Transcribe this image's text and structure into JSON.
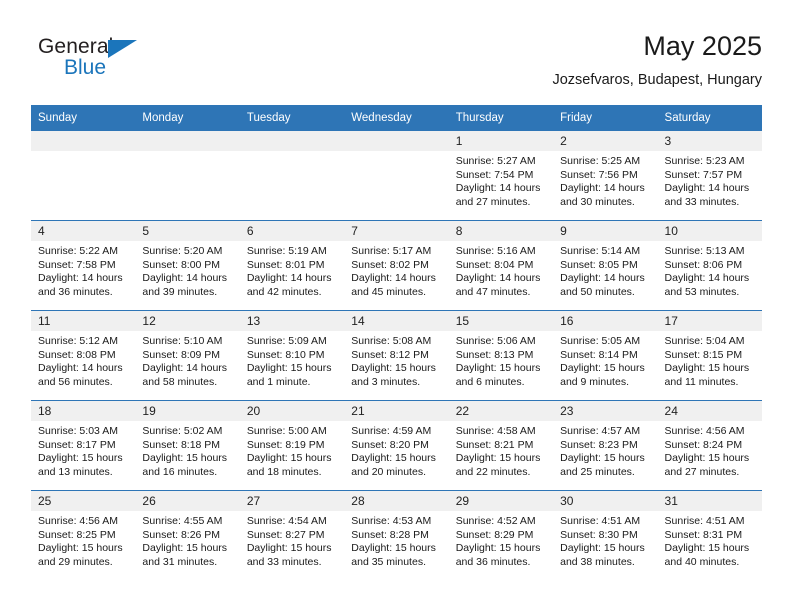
{
  "brand": {
    "name_part1": "General",
    "name_part2": "Blue",
    "flag_icon": "blue-flag-triangle",
    "accent_color": "#1b75bb"
  },
  "header": {
    "title": "May 2025",
    "subtitle": "Jozsefvaros, Budapest, Hungary"
  },
  "calendar": {
    "header_bg": "#2e75b6",
    "daynum_bg": "#f0f0f0",
    "weekday_headers": [
      "Sunday",
      "Monday",
      "Tuesday",
      "Wednesday",
      "Thursday",
      "Friday",
      "Saturday"
    ],
    "weeks": [
      [
        {
          "day": "",
          "sunrise": "",
          "sunset": "",
          "daylight": ""
        },
        {
          "day": "",
          "sunrise": "",
          "sunset": "",
          "daylight": ""
        },
        {
          "day": "",
          "sunrise": "",
          "sunset": "",
          "daylight": ""
        },
        {
          "day": "",
          "sunrise": "",
          "sunset": "",
          "daylight": ""
        },
        {
          "day": "1",
          "sunrise": "Sunrise: 5:27 AM",
          "sunset": "Sunset: 7:54 PM",
          "daylight": "Daylight: 14 hours and 27 minutes."
        },
        {
          "day": "2",
          "sunrise": "Sunrise: 5:25 AM",
          "sunset": "Sunset: 7:56 PM",
          "daylight": "Daylight: 14 hours and 30 minutes."
        },
        {
          "day": "3",
          "sunrise": "Sunrise: 5:23 AM",
          "sunset": "Sunset: 7:57 PM",
          "daylight": "Daylight: 14 hours and 33 minutes."
        }
      ],
      [
        {
          "day": "4",
          "sunrise": "Sunrise: 5:22 AM",
          "sunset": "Sunset: 7:58 PM",
          "daylight": "Daylight: 14 hours and 36 minutes."
        },
        {
          "day": "5",
          "sunrise": "Sunrise: 5:20 AM",
          "sunset": "Sunset: 8:00 PM",
          "daylight": "Daylight: 14 hours and 39 minutes."
        },
        {
          "day": "6",
          "sunrise": "Sunrise: 5:19 AM",
          "sunset": "Sunset: 8:01 PM",
          "daylight": "Daylight: 14 hours and 42 minutes."
        },
        {
          "day": "7",
          "sunrise": "Sunrise: 5:17 AM",
          "sunset": "Sunset: 8:02 PM",
          "daylight": "Daylight: 14 hours and 45 minutes."
        },
        {
          "day": "8",
          "sunrise": "Sunrise: 5:16 AM",
          "sunset": "Sunset: 8:04 PM",
          "daylight": "Daylight: 14 hours and 47 minutes."
        },
        {
          "day": "9",
          "sunrise": "Sunrise: 5:14 AM",
          "sunset": "Sunset: 8:05 PM",
          "daylight": "Daylight: 14 hours and 50 minutes."
        },
        {
          "day": "10",
          "sunrise": "Sunrise: 5:13 AM",
          "sunset": "Sunset: 8:06 PM",
          "daylight": "Daylight: 14 hours and 53 minutes."
        }
      ],
      [
        {
          "day": "11",
          "sunrise": "Sunrise: 5:12 AM",
          "sunset": "Sunset: 8:08 PM",
          "daylight": "Daylight: 14 hours and 56 minutes."
        },
        {
          "day": "12",
          "sunrise": "Sunrise: 5:10 AM",
          "sunset": "Sunset: 8:09 PM",
          "daylight": "Daylight: 14 hours and 58 minutes."
        },
        {
          "day": "13",
          "sunrise": "Sunrise: 5:09 AM",
          "sunset": "Sunset: 8:10 PM",
          "daylight": "Daylight: 15 hours and 1 minute."
        },
        {
          "day": "14",
          "sunrise": "Sunrise: 5:08 AM",
          "sunset": "Sunset: 8:12 PM",
          "daylight": "Daylight: 15 hours and 3 minutes."
        },
        {
          "day": "15",
          "sunrise": "Sunrise: 5:06 AM",
          "sunset": "Sunset: 8:13 PM",
          "daylight": "Daylight: 15 hours and 6 minutes."
        },
        {
          "day": "16",
          "sunrise": "Sunrise: 5:05 AM",
          "sunset": "Sunset: 8:14 PM",
          "daylight": "Daylight: 15 hours and 9 minutes."
        },
        {
          "day": "17",
          "sunrise": "Sunrise: 5:04 AM",
          "sunset": "Sunset: 8:15 PM",
          "daylight": "Daylight: 15 hours and 11 minutes."
        }
      ],
      [
        {
          "day": "18",
          "sunrise": "Sunrise: 5:03 AM",
          "sunset": "Sunset: 8:17 PM",
          "daylight": "Daylight: 15 hours and 13 minutes."
        },
        {
          "day": "19",
          "sunrise": "Sunrise: 5:02 AM",
          "sunset": "Sunset: 8:18 PM",
          "daylight": "Daylight: 15 hours and 16 minutes."
        },
        {
          "day": "20",
          "sunrise": "Sunrise: 5:00 AM",
          "sunset": "Sunset: 8:19 PM",
          "daylight": "Daylight: 15 hours and 18 minutes."
        },
        {
          "day": "21",
          "sunrise": "Sunrise: 4:59 AM",
          "sunset": "Sunset: 8:20 PM",
          "daylight": "Daylight: 15 hours and 20 minutes."
        },
        {
          "day": "22",
          "sunrise": "Sunrise: 4:58 AM",
          "sunset": "Sunset: 8:21 PM",
          "daylight": "Daylight: 15 hours and 22 minutes."
        },
        {
          "day": "23",
          "sunrise": "Sunrise: 4:57 AM",
          "sunset": "Sunset: 8:23 PM",
          "daylight": "Daylight: 15 hours and 25 minutes."
        },
        {
          "day": "24",
          "sunrise": "Sunrise: 4:56 AM",
          "sunset": "Sunset: 8:24 PM",
          "daylight": "Daylight: 15 hours and 27 minutes."
        }
      ],
      [
        {
          "day": "25",
          "sunrise": "Sunrise: 4:56 AM",
          "sunset": "Sunset: 8:25 PM",
          "daylight": "Daylight: 15 hours and 29 minutes."
        },
        {
          "day": "26",
          "sunrise": "Sunrise: 4:55 AM",
          "sunset": "Sunset: 8:26 PM",
          "daylight": "Daylight: 15 hours and 31 minutes."
        },
        {
          "day": "27",
          "sunrise": "Sunrise: 4:54 AM",
          "sunset": "Sunset: 8:27 PM",
          "daylight": "Daylight: 15 hours and 33 minutes."
        },
        {
          "day": "28",
          "sunrise": "Sunrise: 4:53 AM",
          "sunset": "Sunset: 8:28 PM",
          "daylight": "Daylight: 15 hours and 35 minutes."
        },
        {
          "day": "29",
          "sunrise": "Sunrise: 4:52 AM",
          "sunset": "Sunset: 8:29 PM",
          "daylight": "Daylight: 15 hours and 36 minutes."
        },
        {
          "day": "30",
          "sunrise": "Sunrise: 4:51 AM",
          "sunset": "Sunset: 8:30 PM",
          "daylight": "Daylight: 15 hours and 38 minutes."
        },
        {
          "day": "31",
          "sunrise": "Sunrise: 4:51 AM",
          "sunset": "Sunset: 8:31 PM",
          "daylight": "Daylight: 15 hours and 40 minutes."
        }
      ]
    ]
  }
}
